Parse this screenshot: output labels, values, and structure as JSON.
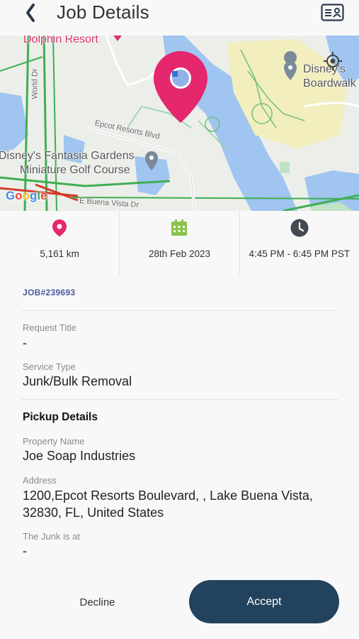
{
  "header": {
    "title": "Job Details",
    "back_icon": "chevron-left-icon",
    "right_icon": "id-card-icon"
  },
  "map": {
    "labels": {
      "resort": "Dolphin Resort",
      "fantasia_line1": "Disney's Fantasia Gardens",
      "fantasia_line2": "Miniature Golf Course",
      "boardwalk_line1": "Disney's",
      "boardwalk_line2": "Boardwalk",
      "epcot_blvd": "Epcot Resorts Blvd",
      "world_dr": "World Dr",
      "e_buena": "E Buena Vista Dr",
      "google": "Google"
    },
    "marker_color": "#e5276e"
  },
  "info": {
    "distance": "5,161 km",
    "date": "28th Feb 2023",
    "time": "4:45 PM - 6:45 PM PST",
    "distance_icon": "location-pin-icon",
    "date_icon": "calendar-icon",
    "time_icon": "clock-icon"
  },
  "job": {
    "number": "JOB#239693",
    "request_title_label": "Request Title",
    "request_title_value": "-",
    "service_type_label": "Service Type",
    "service_type_value": "Junk/Bulk Removal",
    "pickup_heading": "Pickup Details",
    "property_name_label": "Property Name",
    "property_name_value": "Joe Soap Industries",
    "address_label": "Address",
    "address_line1": "1200,Epcot Resorts Boulevard, , Lake Buena Vista,",
    "address_line2": "32830, FL, United States",
    "junk_location_label": "The Junk is at",
    "junk_location_value": "-"
  },
  "actions": {
    "decline": "Decline",
    "accept": "Accept"
  },
  "colors": {
    "accent_navy": "#23425e",
    "pin_pink": "#e5276e",
    "calendar_green": "#8bc34a",
    "job_number_blue": "#4b5aa0"
  }
}
